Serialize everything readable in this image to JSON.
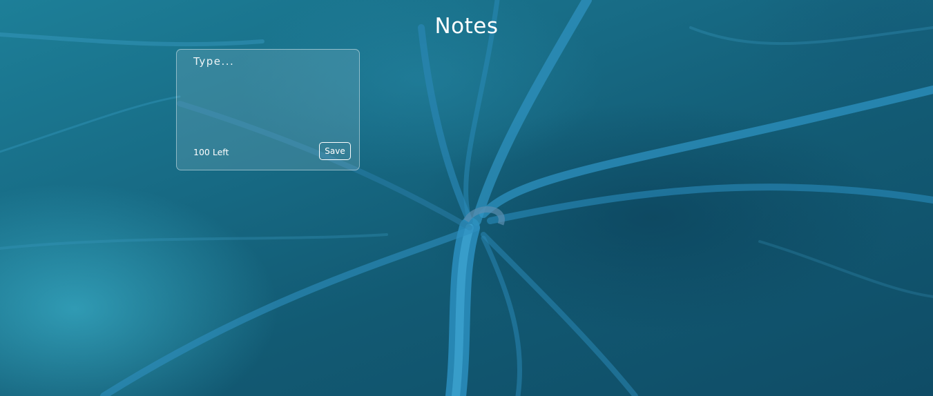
{
  "page": {
    "title": "Notes"
  },
  "note_editor": {
    "placeholder": "Type...",
    "value": "",
    "chars_left_label": "100 Left",
    "save_label": "Save"
  },
  "theme": {
    "background": "#176a84",
    "text": "#ffffff",
    "card_border": "rgba(255,255,255,0.45)"
  }
}
